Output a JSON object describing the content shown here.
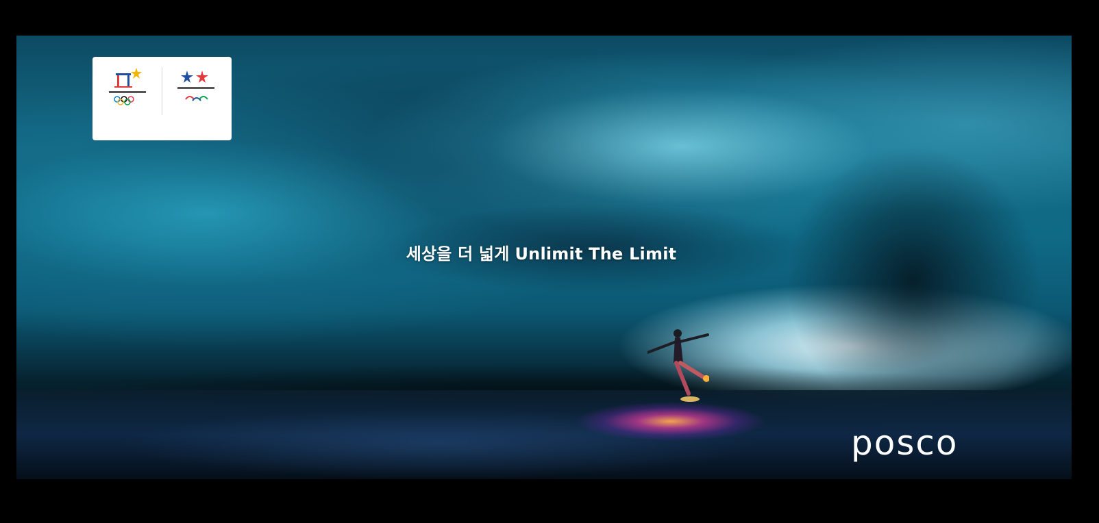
{
  "ad": {
    "tagline_korean": "세상을 더 넓게",
    "tagline_english": "Unlimit The Limit",
    "brand": "posco"
  },
  "logos": {
    "olympic_icon": "pyeongchang-2018-olympic-emblem",
    "paralympic_icon": "pyeongchang-2018-paralympic-emblem"
  },
  "colors": {
    "ice_blue": "#136a85",
    "background": "#000000",
    "text": "#ffffff"
  }
}
